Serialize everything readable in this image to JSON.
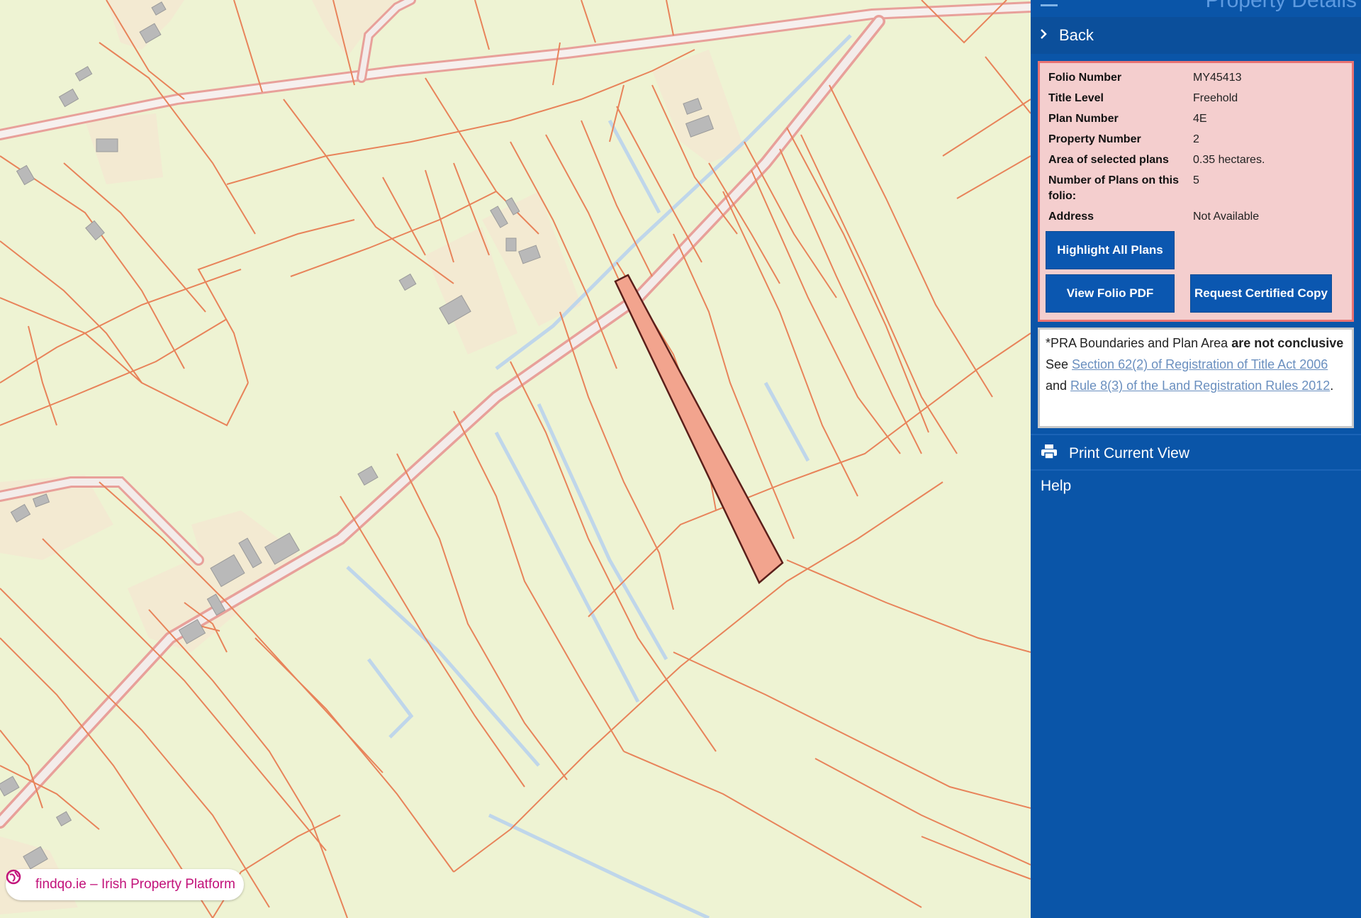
{
  "panel": {
    "title": "Property Details",
    "back_label": "Back",
    "details": [
      {
        "label": "Folio Number",
        "value": "MY45413"
      },
      {
        "label": "Title Level",
        "value": "Freehold"
      },
      {
        "label": "Plan Number",
        "value": "4E"
      },
      {
        "label": "Property Number",
        "value": "2"
      },
      {
        "label": "Area of selected plans",
        "value": "0.35 hectares."
      },
      {
        "label": "Number of Plans on this folio:",
        "value": "5"
      },
      {
        "label": "Address",
        "value": "Not Available"
      }
    ],
    "buttons": {
      "highlight_all": "Highlight All Plans",
      "view_folio_pdf": "View Folio PDF",
      "request_copy": "Request Certified Copy"
    },
    "disclaimer": {
      "prefix": "*PRA Boundaries and Plan Area ",
      "bold": "are not conclusive",
      "see": " See ",
      "link1": "Section 62(2) of Registration of Title Act 2006",
      "and": " and ",
      "link2": "Rule 8(3) of the Land Registration Rules 2012",
      "end": "."
    },
    "print_label": "Print Current View",
    "help_label": "Help"
  },
  "map": {
    "badge_text": "findqo.ie – Irish Property Platform",
    "icons": [
      "print-icon",
      "globe-icon",
      "menu-icon",
      "chevron-right-icon"
    ],
    "colors": {
      "background": "#eef3d3",
      "boundary": "#e8835a",
      "road": "#f2c9c1",
      "water": "#bfd6ea",
      "building": "#b9b9b9",
      "house_plot": "#f3ead2",
      "selected_plot": "#f2a48e",
      "panel": "#0a55a8",
      "badge_text": "#c2127a"
    }
  }
}
